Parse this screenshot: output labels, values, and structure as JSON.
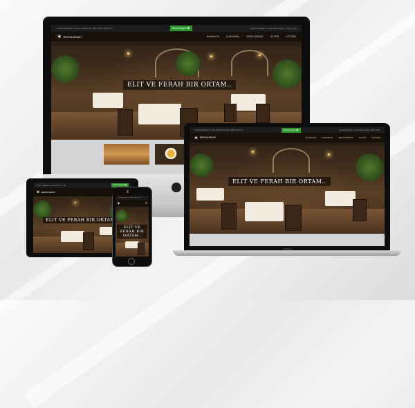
{
  "site": {
    "address": "* Cebeci Mahallesi, Cinnah Caddesi No: 195 | 0850 000 00 00",
    "address_short": "* Cebeci Mahallesi, Cinnah Cad. No: 195",
    "reserve_label": "Rezervasyon ☎",
    "lang_links": "Sosyal Medyalar | Online Rezervasyon | Bize Ulaşın",
    "logo_name": "RESTAURANT",
    "logo_sub": "Web Sitesi",
    "menu": [
      "ANASAYFA",
      "KURUMSAL",
      "MENÜLERİMİZ",
      "GALERİ",
      "İLETİŞİM"
    ],
    "hero_caption": "ELIT VE FERAH BIR ORTAM..",
    "hero_caption_short": "ELIT VE FERAH BIR ORTAM..",
    "phone_caption": "ELIT VE FERAH BIR ORTAM.."
  },
  "devices": {
    "laptop_brand": "MacBook"
  },
  "colors": {
    "accent_green": "#2e9a2e",
    "device_black": "#0d0d0d",
    "silver": "#c8c8c8"
  }
}
